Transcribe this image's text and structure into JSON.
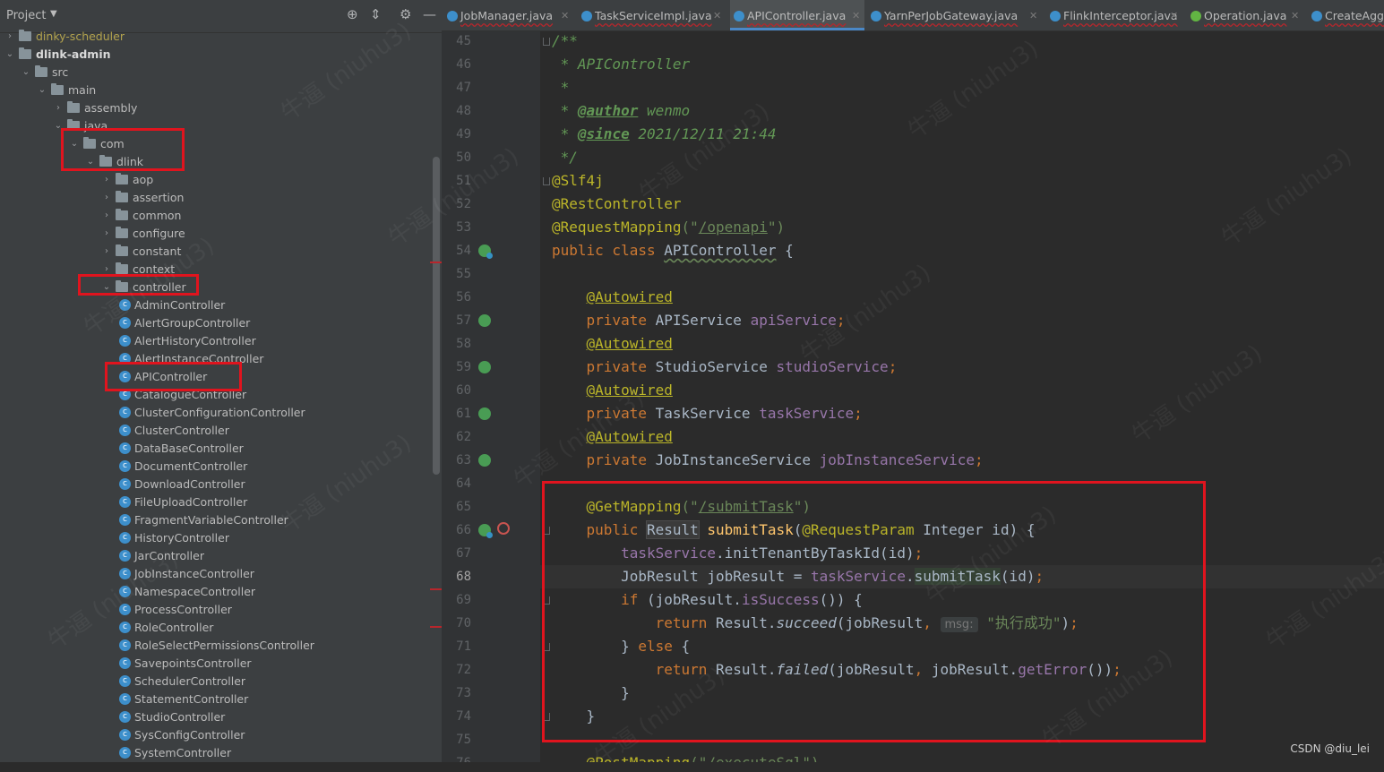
{
  "project_panel": {
    "title": "Project",
    "dropdown_icon": "chevron-down-icon",
    "header_icons": [
      "target-icon",
      "collapse-icon",
      "gear-icon",
      "minimize-icon"
    ],
    "tree": [
      {
        "label": "dinky-scheduler",
        "kind": "module",
        "expanded": false
      },
      {
        "label": "dlink-admin",
        "kind": "module",
        "expanded": true
      },
      {
        "label": "src",
        "kind": "folder",
        "expanded": true
      },
      {
        "label": "main",
        "kind": "folder",
        "expanded": true
      },
      {
        "label": "assembly",
        "kind": "folder",
        "expanded": false
      },
      {
        "label": "java",
        "kind": "folder",
        "expanded": true
      },
      {
        "label": "com",
        "kind": "package",
        "expanded": true
      },
      {
        "label": "dlink",
        "kind": "package",
        "expanded": true
      },
      {
        "label": "aop",
        "kind": "package",
        "expanded": false
      },
      {
        "label": "assertion",
        "kind": "package",
        "expanded": false
      },
      {
        "label": "common",
        "kind": "package",
        "expanded": false
      },
      {
        "label": "configure",
        "kind": "package",
        "expanded": false
      },
      {
        "label": "constant",
        "kind": "package",
        "expanded": false
      },
      {
        "label": "context",
        "kind": "package",
        "expanded": false
      },
      {
        "label": "controller",
        "kind": "package",
        "expanded": true
      },
      {
        "label": "AdminController",
        "kind": "class"
      },
      {
        "label": "AlertGroupController",
        "kind": "class"
      },
      {
        "label": "AlertHistoryController",
        "kind": "class"
      },
      {
        "label": "AlertInstanceController",
        "kind": "class"
      },
      {
        "label": "APIController",
        "kind": "class"
      },
      {
        "label": "CatalogueController",
        "kind": "class"
      },
      {
        "label": "ClusterConfigurationController",
        "kind": "class"
      },
      {
        "label": "ClusterController",
        "kind": "class"
      },
      {
        "label": "DataBaseController",
        "kind": "class"
      },
      {
        "label": "DocumentController",
        "kind": "class"
      },
      {
        "label": "DownloadController",
        "kind": "class"
      },
      {
        "label": "FileUploadController",
        "kind": "class"
      },
      {
        "label": "FragmentVariableController",
        "kind": "class"
      },
      {
        "label": "HistoryController",
        "kind": "class"
      },
      {
        "label": "JarController",
        "kind": "class"
      },
      {
        "label": "JobInstanceController",
        "kind": "class"
      },
      {
        "label": "NamespaceController",
        "kind": "class"
      },
      {
        "label": "ProcessController",
        "kind": "class"
      },
      {
        "label": "RoleController",
        "kind": "class"
      },
      {
        "label": "RoleSelectPermissionsController",
        "kind": "class"
      },
      {
        "label": "SavepointsController",
        "kind": "class"
      },
      {
        "label": "SchedulerController",
        "kind": "class"
      },
      {
        "label": "StatementController",
        "kind": "class"
      },
      {
        "label": "StudioController",
        "kind": "class"
      },
      {
        "label": "SysConfigController",
        "kind": "class"
      },
      {
        "label": "SystemController",
        "kind": "class"
      }
    ]
  },
  "tabs": [
    {
      "label": "JobManager.java",
      "icon": "class-icon",
      "active": false
    },
    {
      "label": "TaskServiceImpl.java",
      "icon": "class-icon",
      "active": false
    },
    {
      "label": "APIController.java",
      "icon": "class-icon",
      "active": true
    },
    {
      "label": "YarnPerJobGateway.java",
      "icon": "class-icon",
      "active": false
    },
    {
      "label": "FlinkInterceptor.java",
      "icon": "class-icon",
      "active": false
    },
    {
      "label": "Operation.java",
      "icon": "interface-icon",
      "active": false
    },
    {
      "label": "CreateAgg",
      "icon": "class-icon",
      "active": false
    }
  ],
  "editor": {
    "current_line": 68,
    "lines": [
      {
        "no": 45,
        "parts": [
          [
            "/**",
            "comment"
          ]
        ]
      },
      {
        "no": 46,
        "parts": [
          [
            " * APIController",
            "comment"
          ]
        ]
      },
      {
        "no": 47,
        "parts": [
          [
            " *",
            "comment"
          ]
        ]
      },
      {
        "no": 48,
        "parts": [
          [
            " * ",
            "comment"
          ],
          [
            "@author",
            "tag"
          ],
          [
            " wenmo",
            "comment"
          ]
        ]
      },
      {
        "no": 49,
        "parts": [
          [
            " * ",
            "comment"
          ],
          [
            "@since",
            "tag"
          ],
          [
            " 2021/12/11 21:44",
            "comment"
          ]
        ]
      },
      {
        "no": 50,
        "parts": [
          [
            " */",
            "comment"
          ]
        ]
      },
      {
        "no": 51,
        "parts": [
          [
            "@Slf4j",
            "ann"
          ]
        ]
      },
      {
        "no": 52,
        "parts": [
          [
            "@RestController",
            "ann"
          ]
        ]
      },
      {
        "no": 53,
        "parts": [
          [
            "@RequestMapping",
            "ann"
          ],
          [
            "(\"",
            "str"
          ],
          [
            "/openapi",
            "str-u"
          ],
          [
            "\")",
            "str"
          ]
        ]
      },
      {
        "no": 54,
        "parts": [
          [
            "public class ",
            "kw"
          ],
          [
            "APIController",
            "wavy"
          ],
          [
            " {",
            "plain"
          ]
        ]
      },
      {
        "no": 55,
        "parts": []
      },
      {
        "no": 56,
        "parts": [
          [
            "    ",
            "plain"
          ],
          [
            "@Autowired",
            "ann-u"
          ]
        ]
      },
      {
        "no": 57,
        "parts": [
          [
            "    ",
            "plain"
          ],
          [
            "private ",
            "kw"
          ],
          [
            "APIService ",
            "plain"
          ],
          [
            "apiService",
            "field"
          ],
          [
            ";",
            "kw"
          ]
        ]
      },
      {
        "no": 58,
        "parts": [
          [
            "    ",
            "plain"
          ],
          [
            "@Autowired",
            "ann-u"
          ]
        ]
      },
      {
        "no": 59,
        "parts": [
          [
            "    ",
            "plain"
          ],
          [
            "private ",
            "kw"
          ],
          [
            "StudioService ",
            "plain"
          ],
          [
            "studioService",
            "field"
          ],
          [
            ";",
            "kw"
          ]
        ]
      },
      {
        "no": 60,
        "parts": [
          [
            "    ",
            "plain"
          ],
          [
            "@Autowired",
            "ann-u"
          ]
        ]
      },
      {
        "no": 61,
        "parts": [
          [
            "    ",
            "plain"
          ],
          [
            "private ",
            "kw"
          ],
          [
            "TaskService ",
            "plain"
          ],
          [
            "taskService",
            "field"
          ],
          [
            ";",
            "kw"
          ]
        ]
      },
      {
        "no": 62,
        "parts": [
          [
            "    ",
            "plain"
          ],
          [
            "@Autowired",
            "ann-u"
          ]
        ]
      },
      {
        "no": 63,
        "parts": [
          [
            "    ",
            "plain"
          ],
          [
            "private ",
            "kw"
          ],
          [
            "JobInstanceService ",
            "plain"
          ],
          [
            "jobInstanceService",
            "field"
          ],
          [
            ";",
            "kw"
          ]
        ]
      },
      {
        "no": 64,
        "parts": []
      },
      {
        "no": 65,
        "parts": [
          [
            "    ",
            "plain"
          ],
          [
            "@GetMapping",
            "ann"
          ],
          [
            "(\"",
            "str"
          ],
          [
            "/submitTask",
            "str-u"
          ],
          [
            "\")",
            "str"
          ]
        ]
      },
      {
        "no": 66,
        "parts": [
          [
            "    ",
            "plain"
          ],
          [
            "public ",
            "kw"
          ],
          [
            "Result",
            "hl"
          ],
          [
            " ",
            "plain"
          ],
          [
            "submitTask",
            "method"
          ],
          [
            "(",
            "plain"
          ],
          [
            "@RequestParam",
            "ann"
          ],
          [
            " Integer id) {",
            "plain"
          ]
        ]
      },
      {
        "no": 67,
        "parts": [
          [
            "        ",
            "plain"
          ],
          [
            "taskService",
            "field"
          ],
          [
            ".initTenantByTaskId(id)",
            "plain"
          ],
          [
            ";",
            "kw"
          ]
        ]
      },
      {
        "no": 68,
        "parts": [
          [
            "        ",
            "plain"
          ],
          [
            "JobResult jobResult = ",
            "plain"
          ],
          [
            "taskService",
            "field"
          ],
          [
            ".",
            "plain"
          ],
          [
            "submitTask",
            "sel"
          ],
          [
            "(id)",
            "plain"
          ],
          [
            ";",
            "kw"
          ]
        ]
      },
      {
        "no": 69,
        "parts": [
          [
            "        ",
            "plain"
          ],
          [
            "if ",
            "kw"
          ],
          [
            "(jobResult.",
            "plain"
          ],
          [
            "isSuccess",
            "field"
          ],
          [
            "()) {",
            "plain"
          ]
        ]
      },
      {
        "no": 70,
        "parts": [
          [
            "            ",
            "plain"
          ],
          [
            "return ",
            "kw"
          ],
          [
            "Result.",
            "plain"
          ],
          [
            "succeed",
            "italic"
          ],
          [
            "(jobResult",
            "plain"
          ],
          [
            ", ",
            "kw"
          ],
          [
            "msg:",
            "hint"
          ],
          [
            " \"执行成功\"",
            "str"
          ],
          [
            ")",
            "plain"
          ],
          [
            ";",
            "kw"
          ]
        ]
      },
      {
        "no": 71,
        "parts": [
          [
            "        ",
            "plain"
          ],
          [
            "} ",
            "plain"
          ],
          [
            "else ",
            "kw"
          ],
          [
            "{",
            "plain"
          ]
        ]
      },
      {
        "no": 72,
        "parts": [
          [
            "            ",
            "plain"
          ],
          [
            "return ",
            "kw"
          ],
          [
            "Result.",
            "plain"
          ],
          [
            "failed",
            "italic"
          ],
          [
            "(jobResult",
            "plain"
          ],
          [
            ", ",
            "kw"
          ],
          [
            "jobResult.",
            "plain"
          ],
          [
            "getError",
            "field"
          ],
          [
            "())",
            "plain"
          ],
          [
            ";",
            "kw"
          ]
        ]
      },
      {
        "no": 73,
        "parts": [
          [
            "        ",
            "plain"
          ],
          [
            "}",
            "plain"
          ]
        ]
      },
      {
        "no": 74,
        "parts": [
          [
            "    ",
            "plain"
          ],
          [
            "}",
            "plain"
          ]
        ]
      },
      {
        "no": 75,
        "parts": []
      },
      {
        "no": 76,
        "parts": [
          [
            "    ",
            "plain"
          ],
          [
            "@PostMapping",
            "ann"
          ],
          [
            "(\"",
            "str"
          ],
          [
            "/executeSql",
            "str-u"
          ],
          [
            "\")",
            "str"
          ]
        ]
      }
    ]
  },
  "watermark_text": "CSDN @diu_lei",
  "background_watermark": "牛逼 (niuhu3)",
  "colors": {
    "highlight_box": "#e0141e",
    "active_tab": "#4a88c7",
    "panel_bg": "#3c3f41",
    "editor_bg": "#2b2b2b"
  }
}
